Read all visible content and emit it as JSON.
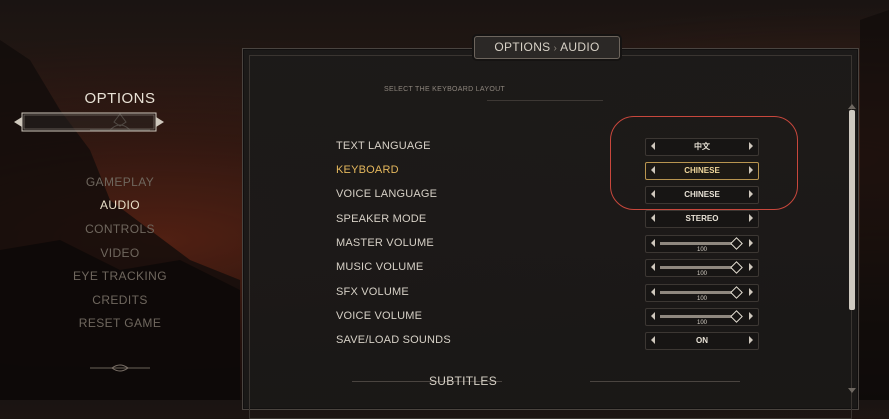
{
  "left_menu": {
    "title": "OPTIONS",
    "items": [
      "GAMEPLAY",
      "AUDIO",
      "CONTROLS",
      "VIDEO",
      "EYE TRACKING",
      "CREDITS",
      "RESET GAME"
    ],
    "active_index": 1
  },
  "tab": {
    "section": "OPTIONS",
    "separator": "›",
    "subsection": "AUDIO"
  },
  "hint": "SELECT THE KEYBOARD LAYOUT",
  "settings": [
    {
      "label": "TEXT LANGUAGE",
      "type": "select",
      "value": "中文"
    },
    {
      "label": "KEYBOARD",
      "type": "select",
      "value": "CHINESE",
      "active": true
    },
    {
      "label": "VOICE LANGUAGE",
      "type": "select",
      "value": "CHINESE"
    },
    {
      "label": "SPEAKER MODE",
      "type": "select",
      "value": "STEREO"
    },
    {
      "label": "MASTER VOLUME",
      "type": "slider",
      "value": "100",
      "level": 1.0
    },
    {
      "label": "MUSIC VOLUME",
      "type": "slider",
      "value": "100",
      "level": 1.0
    },
    {
      "label": "SFX VOLUME",
      "type": "slider",
      "value": "100",
      "level": 1.0
    },
    {
      "label": "VOICE VOLUME",
      "type": "slider",
      "value": "100",
      "level": 1.0
    },
    {
      "label": "SAVE/LOAD SOUNDS",
      "type": "select",
      "value": "ON"
    }
  ],
  "section_footer": "SUBTITLES",
  "colors": {
    "accent_gold": "#e5b85d",
    "highlight_red": "#c8473c",
    "text": "#d6d0c6",
    "inactive": "#6f675e"
  }
}
